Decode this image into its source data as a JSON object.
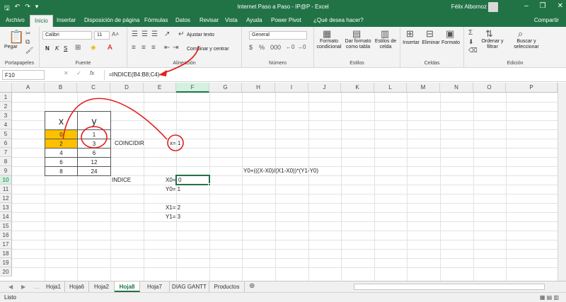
{
  "window": {
    "title": "Internet Paso a Paso - IP@P  -  Excel",
    "user": "Félix Albornoz",
    "minimize": "–",
    "restore": "❐",
    "close": "✕"
  },
  "qat": {
    "save": "🖫",
    "undo": "↶",
    "redo": "↷",
    "more": "▾"
  },
  "tabs": [
    "Archivo",
    "Inicio",
    "Insertar",
    "Disposición de página",
    "Fórmulas",
    "Datos",
    "Revisar",
    "Vista",
    "Ayuda",
    "Power Pivot",
    "¿Qué desea hacer?"
  ],
  "share": "Compartir",
  "ribbon": {
    "paste": "Pegar",
    "clipboard": "Portapapeles",
    "font_name": "Calibri",
    "font_size": "11",
    "font_group": "Fuente",
    "bold": "N",
    "italic": "K",
    "underline": "S",
    "wrap_text": "Ajustar texto",
    "merge_center": "Combinar y centrar",
    "alignment_group": "Alineación",
    "number_format": "General",
    "number_group": "Número",
    "cond_format": [
      "Formato",
      "condicional"
    ],
    "format_table": [
      "Dar formato",
      "como tabla"
    ],
    "cell_styles": [
      "Estilos de",
      "celda"
    ],
    "styles_group": "Estilos",
    "insert": "Insertar",
    "delete": "Eliminar",
    "format": "Formato",
    "cells_group": "Celdas",
    "sort_filter": [
      "Ordenar y",
      "filtrar"
    ],
    "find_select": [
      "Buscar y",
      "seleccionar"
    ],
    "editing_group": "Edición",
    "sum_icon": "Σ"
  },
  "formula_bar": {
    "name_box": "F10",
    "cancel": "✕",
    "enter": "✓",
    "fx": "fx",
    "formula": "=INDICE(B4:B8;C4)"
  },
  "columns": [
    "A",
    "B",
    "C",
    "D",
    "E",
    "F",
    "G",
    "H",
    "I",
    "J",
    "K",
    "L",
    "M",
    "N",
    "O",
    "P"
  ],
  "rows": [
    "1",
    "2",
    "3",
    "4",
    "5",
    "6",
    "7",
    "8",
    "9",
    "10",
    "11",
    "12",
    "13",
    "14",
    "15",
    "16",
    "17",
    "18",
    "19",
    "20"
  ],
  "table": {
    "header_x": "x",
    "header_y": "y",
    "x_values": [
      "0",
      "2",
      "4",
      "6",
      "8"
    ],
    "y_values": [
      "1",
      "3",
      "6",
      "12",
      "24"
    ]
  },
  "cells": {
    "coincidir": "COINCIDIR",
    "x_eq": "x= 1",
    "indice": "INDICE",
    "x0": "X0=",
    "f10": "0",
    "y0": "Y0= 1",
    "x1": "X1= 2",
    "y1": "Y1= 3",
    "formula_text": "Y0+(((X-X0)/(X1-X0))*(Y1-Y0)"
  },
  "sheets": [
    "Hoja1",
    "Hoja6",
    "Hoja2",
    "Hoja8",
    "Hoja7",
    "DIAG GANTT",
    "Productos"
  ],
  "active_sheet": "Hoja8",
  "status": "Listo",
  "annotation_color": "#e0201e",
  "accent_color": "#217346"
}
